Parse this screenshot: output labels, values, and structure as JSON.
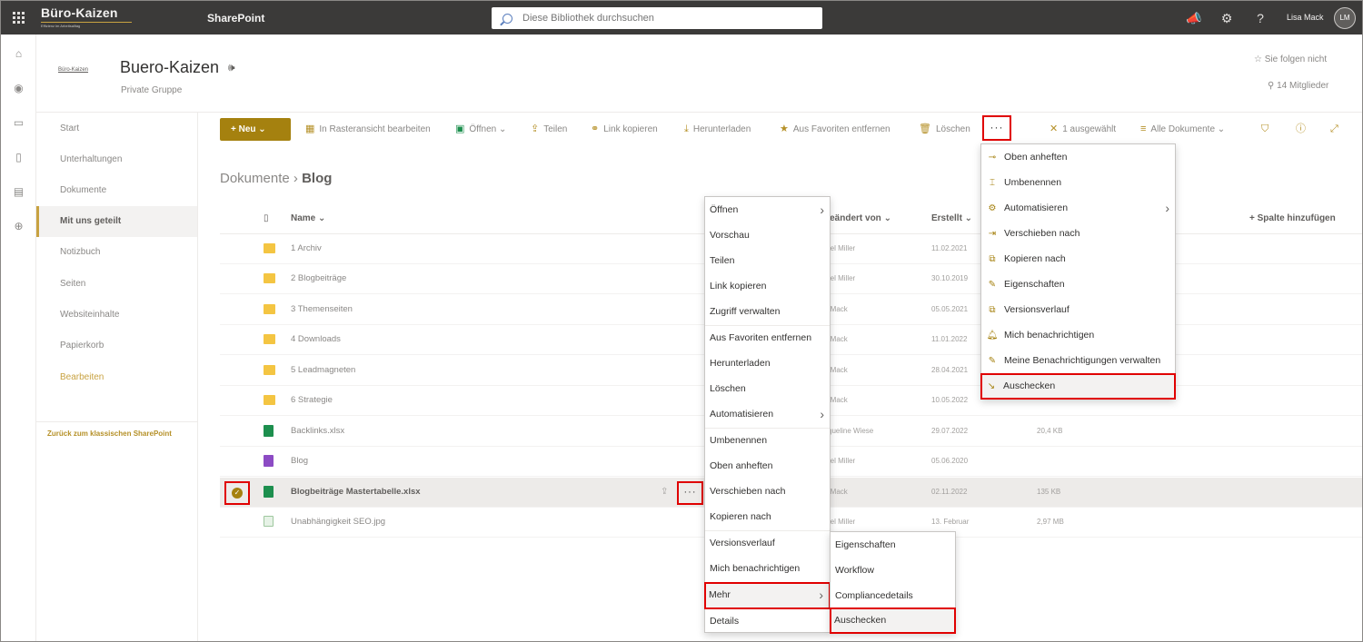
{
  "suite": {
    "logo_text": "Büro-Kaizen",
    "logo_tagline": "Effizienz im Arbeitsalltag",
    "app_name": "SharePoint",
    "search_placeholder": "Diese Bibliothek durchsuchen",
    "user_name": "Lisa Mack",
    "user_initials": "LM"
  },
  "site": {
    "logo_label": "Büro-Kaizen",
    "title": "Buero-Kaizen",
    "subtitle": "Private Gruppe",
    "follow_label": "Sie folgen nicht",
    "members_label": "14 Mitglieder"
  },
  "leftnav": {
    "items": [
      "Start",
      "Unterhaltungen",
      "Dokumente",
      "Mit uns geteilt",
      "Notizbuch",
      "Seiten",
      "Websiteinhalte",
      "Papierkorb",
      "Bearbeiten"
    ],
    "back_link": "Zurück zum klassischen SharePoint"
  },
  "commandbar": {
    "new_label": "Neu",
    "grid_edit": "In Rasteransicht bearbeiten",
    "open": "Öffnen",
    "share": "Teilen",
    "copy_link": "Link kopieren",
    "download": "Herunterladen",
    "remove_favorites": "Aus Favoriten entfernen",
    "delete": "Löschen",
    "more": "···",
    "selected_count": "1 ausgewählt",
    "view_name": "Alle Dokumente"
  },
  "breadcrumb": {
    "parent": "Dokumente",
    "current": "Blog"
  },
  "list": {
    "columns": {
      "name": "Name",
      "modified_by": "geändert von",
      "created": "Erstellt",
      "add_column": "+ Spalte hinzufügen"
    },
    "rows": [
      {
        "name": "1 Archiv",
        "type": "folder",
        "editor": "rcel Miller",
        "created": "11.02.2021",
        "size": ""
      },
      {
        "name": "2 Blogbeiträge",
        "type": "folder",
        "editor": "rcel Miller",
        "created": "30.10.2019",
        "size": ""
      },
      {
        "name": "3 Themenseiten",
        "type": "folder",
        "editor": "a Mack",
        "created": "05.05.2021",
        "size": ""
      },
      {
        "name": "4 Downloads",
        "type": "folder",
        "editor": "a Mack",
        "created": "11.01.2022",
        "size": ""
      },
      {
        "name": "5 Leadmagneten",
        "type": "folder",
        "editor": "a Mack",
        "created": "28.04.2021",
        "size": ""
      },
      {
        "name": "6 Strategie",
        "type": "folder",
        "editor": "a Mack",
        "created": "10.05.2022",
        "size": ""
      },
      {
        "name": "Backlinks.xlsx",
        "type": "xlsx",
        "editor": "cqueline Wiese",
        "created": "29.07.2022",
        "size": "20,4 KB"
      },
      {
        "name": "Blog",
        "type": "onenote",
        "editor": "rcel Miller",
        "created": "05.06.2020",
        "size": ""
      },
      {
        "name": "Blogbeiträge Mastertabelle.xlsx",
        "type": "xlsx",
        "editor": "a Mack",
        "created": "02.11.2022",
        "size": "135 KB"
      },
      {
        "name": "Unabhängigkeit SEO.jpg",
        "type": "jpg",
        "editor": "rcel Miller",
        "created": "13. Februar",
        "size": "2,97 MB"
      }
    ]
  },
  "context_menu": {
    "items": [
      "Öffnen",
      "Vorschau",
      "Teilen",
      "Link kopieren",
      "Zugriff verwalten",
      "Aus Favoriten entfernen",
      "Herunterladen",
      "Löschen",
      "Automatisieren",
      "Umbenennen",
      "Oben anheften",
      "Verschieben nach",
      "Kopieren nach",
      "Versionsverlauf",
      "Mich benachrichtigen",
      "Mehr",
      "Details"
    ]
  },
  "submenu": {
    "items": [
      "Eigenschaften",
      "Workflow",
      "Compliancedetails",
      "Auschecken"
    ]
  },
  "more_menu": {
    "items": [
      "Oben anheften",
      "Umbenennen",
      "Automatisieren",
      "Verschieben nach",
      "Kopieren nach",
      "Eigenschaften",
      "Versionsverlauf",
      "Mich benachrichtigen",
      "Meine Benachrichtigungen verwalten",
      "Auschecken"
    ]
  },
  "colors": {
    "suite_bar": "#3b3a39",
    "accent": "#a5810f",
    "highlight_border": "#e00000"
  }
}
